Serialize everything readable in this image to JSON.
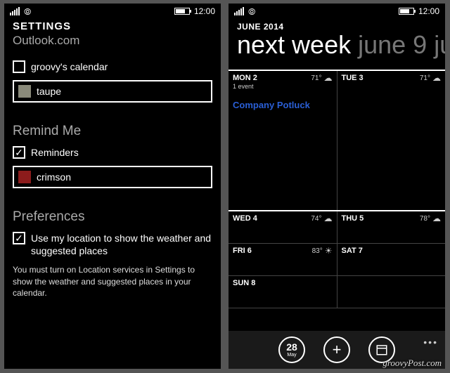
{
  "status": {
    "time": "12:00"
  },
  "settings": {
    "title": "SETTINGS",
    "subtitle": "Outlook.com",
    "cal_checkbox_label": "groovy's calendar",
    "cal_color_label": "taupe",
    "remind_heading": "Remind Me",
    "reminders_label": "Reminders",
    "reminders_color_label": "crimson",
    "prefs_heading": "Preferences",
    "location_label": "Use my location to show the weather and suggested places",
    "location_note": "You must turn on Location services in Settings to show the weather and suggested places in your calendar."
  },
  "calendar": {
    "month": "JUNE 2014",
    "view_label": "next week",
    "range_label": "june 9 ju",
    "days": {
      "mon": {
        "label": "MON 2",
        "temp": "71°",
        "sub": "1 event",
        "event": "Company Potluck"
      },
      "tue": {
        "label": "TUE 3",
        "temp": "71°"
      },
      "wed": {
        "label": "WED 4",
        "temp": "74°"
      },
      "thu": {
        "label": "THU 5",
        "temp": "78°"
      },
      "fri": {
        "label": "FRI 6",
        "temp": "83°"
      },
      "sat": {
        "label": "SAT 7"
      },
      "sun": {
        "label": "SUN 8"
      }
    },
    "appbar": {
      "day_num": "28",
      "day_mon": "May"
    }
  },
  "watermark": "groovyPost.com"
}
